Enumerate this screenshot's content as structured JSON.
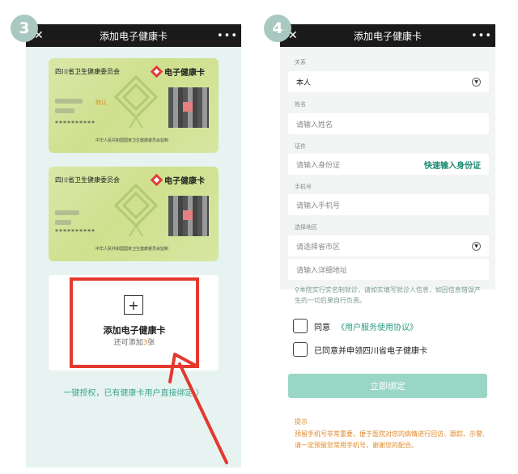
{
  "steps": {
    "left": "3",
    "right": "4"
  },
  "nav": {
    "close": "✕",
    "title": "添加电子健康卡",
    "more": "•••"
  },
  "cards": [
    {
      "issuer": "四川省卫生健康委员会",
      "brand": "电子健康卡",
      "tag": "默认",
      "id": "**********",
      "footer": "中华人民共和国国家卫生健康委员会监制"
    },
    {
      "issuer": "四川省卫生健康委员会",
      "brand": "电子健康卡",
      "tag": "",
      "id": "**********",
      "footer": "中华人民共和国国家卫生健康委员会监制"
    }
  ],
  "add_card": {
    "plus": "+",
    "title": "添加电子健康卡",
    "sub_prefix": "还可添加",
    "count": "3",
    "sub_suffix": "张"
  },
  "one_key_link": "一键授权，已有健康卡用户直接绑定 〉",
  "form": {
    "relation_label": "关系",
    "relation_value": "本人",
    "name_label": "姓名",
    "name_placeholder": "请输入姓名",
    "id_label": "证件",
    "id_placeholder": "请输入身份证",
    "id_quick": "快速输入身份证",
    "phone_label": "手机号",
    "phone_placeholder": "请输入手机号",
    "region_label": "选择地区",
    "region_placeholder": "请选择省市区",
    "address_placeholder": "请输入详细地址"
  },
  "notice": "本院实行实名制就诊，请如实填写就诊人信息，如因信息错误产生的一切后果自行负责。",
  "agree": {
    "prefix": "同意",
    "link": "《用户服务使用协议》"
  },
  "apply_label": "已同意并申领四川省电子健康卡",
  "bind_button": "立即绑定",
  "tips": {
    "title": "提示",
    "body": "预留手机号非常重要，便于医院对您的病情进行回访、跟踪、示警,请一定预留您常用手机号，谢谢您的配合。"
  },
  "colors": {
    "accent": "#3fa58e",
    "highlight": "#e5382e",
    "badge": "#a9c8bf"
  }
}
